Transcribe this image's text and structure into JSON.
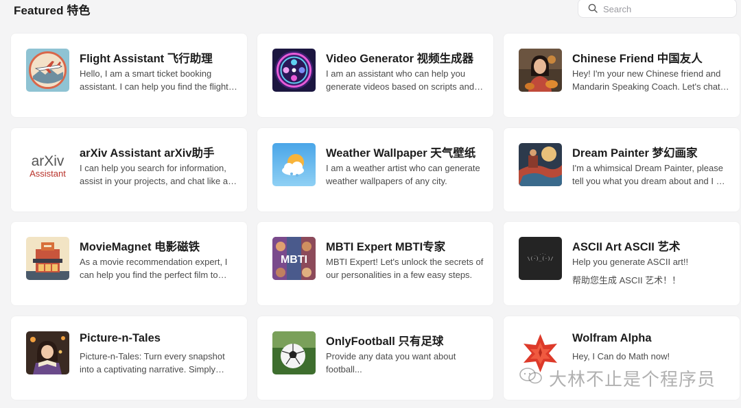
{
  "header": {
    "title": "Featured 特色",
    "search_placeholder": "Search"
  },
  "cards": [
    {
      "name": "Flight Assistant 飞行助理",
      "description": "Hello, I am a smart ticket booking assistant. I can help you find the flight tickets you need.",
      "icon": "airplane-thumbnail"
    },
    {
      "name": "Video Generator 视频生成器",
      "description": "I am an assistant who can help you generate videos based on scripts and descriptions.",
      "icon": "film-reel-thumbnail"
    },
    {
      "name": "Chinese Friend 中国友人",
      "description": "Hey! I'm your new Chinese friend and Mandarin Speaking Coach. Let's chat together.",
      "icon": "woman-portrait-thumbnail"
    },
    {
      "name": "arXiv Assistant arXiv助手",
      "description": "I can help you search for information, assist in your projects, and chat like a friend.",
      "icon": "arxiv-logo-thumbnail",
      "logo_text_1": "arXiv",
      "logo_text_2": "Assistant"
    },
    {
      "name": "Weather Wallpaper 天气壁纸",
      "description": "I am a weather artist who can generate weather wallpapers of any city.",
      "icon": "sun-cloud-thumbnail"
    },
    {
      "name": "Dream Painter 梦幻画家",
      "description": "I'm a whimsical Dream Painter, please tell you what you dream about and I will paint it.",
      "icon": "dream-painting-thumbnail"
    },
    {
      "name": "MovieMagnet 电影磁铁",
      "description": "As a movie recommendation expert, I can help you find the perfect film to watch tonight.",
      "icon": "movie-theater-thumbnail"
    },
    {
      "name": "MBTI Expert MBTI专家",
      "description": "MBTI Expert! Let's unlock the secrets of our personalities in a few easy steps.",
      "icon": "mbti-thumbnail",
      "logo_text_1": "MBTI"
    },
    {
      "name": "ASCII Art ASCII 艺术",
      "description": "Help you generate ASCII art!!",
      "description_2": "帮助您生成 ASCII 艺术！！",
      "icon": "ascii-art-thumbnail"
    },
    {
      "name": "Picture-n-Tales",
      "description": "Picture-n-Tales: Turn every snapshot into a captivating narrative. Simply upload a picture.",
      "icon": "reading-girl-thumbnail"
    },
    {
      "name": "OnlyFootball 只有足球",
      "description": "Provide any data you want about football...",
      "icon": "soccer-ball-thumbnail"
    },
    {
      "name": "Wolfram Alpha",
      "description": "Hey, I Can do Math now!",
      "icon": "wolfram-star-thumbnail"
    }
  ],
  "watermark": {
    "text": "大林不止是个程序员"
  }
}
